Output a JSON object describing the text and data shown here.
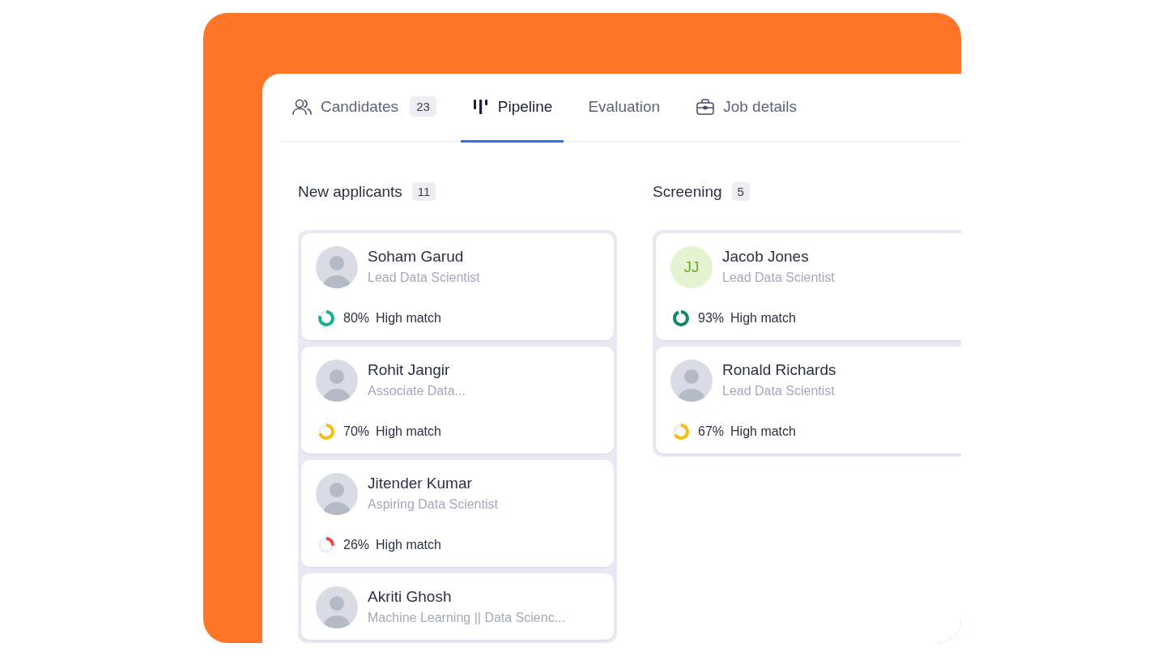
{
  "tabs": [
    {
      "label": "Candidates",
      "count": "23",
      "selected": false
    },
    {
      "label": "Pipeline",
      "selected": true
    },
    {
      "label": "Evaluation",
      "selected": false
    },
    {
      "label": "Job details",
      "selected": false
    }
  ],
  "columns": [
    {
      "title": "New applicants",
      "count": "11",
      "cards": [
        {
          "name": "Soham Garud",
          "role": "Lead Data Scientist",
          "avatar": {
            "kind": "photo"
          },
          "match": {
            "percent": "80%",
            "label": "High match",
            "level": 0.8,
            "color": "#13b38b"
          }
        },
        {
          "name": "Rohit Jangir",
          "role": "Associate Data...",
          "avatar": {
            "kind": "photo"
          },
          "match": {
            "percent": "70%",
            "label": "High match",
            "level": 0.7,
            "color": "#fbbc05"
          }
        },
        {
          "name": "Jitender Kumar",
          "role": "Aspiring Data Scientist",
          "avatar": {
            "kind": "photo"
          },
          "match": {
            "percent": "26%",
            "label": "High match",
            "level": 0.26,
            "color": "#f04545"
          }
        },
        {
          "name": "Akriti Ghosh",
          "role": "Machine Learning || Data Scienc...",
          "avatar": {
            "kind": "photo"
          }
        }
      ]
    },
    {
      "title": "Screening",
      "count": "5",
      "cards": [
        {
          "name": "Jacob Jones",
          "role": "Lead Data Scientist",
          "avatar": {
            "kind": "initials",
            "initials": "JJ"
          },
          "match": {
            "percent": "93%",
            "label": "High match",
            "level": 0.93,
            "color": "#0c8a66"
          }
        },
        {
          "name": "Ronald Richards",
          "role": "Lead Data Scientist",
          "avatar": {
            "kind": "photo"
          },
          "match": {
            "percent": "67%",
            "label": "High match",
            "level": 0.67,
            "color": "#fbbc05"
          }
        }
      ]
    }
  ]
}
